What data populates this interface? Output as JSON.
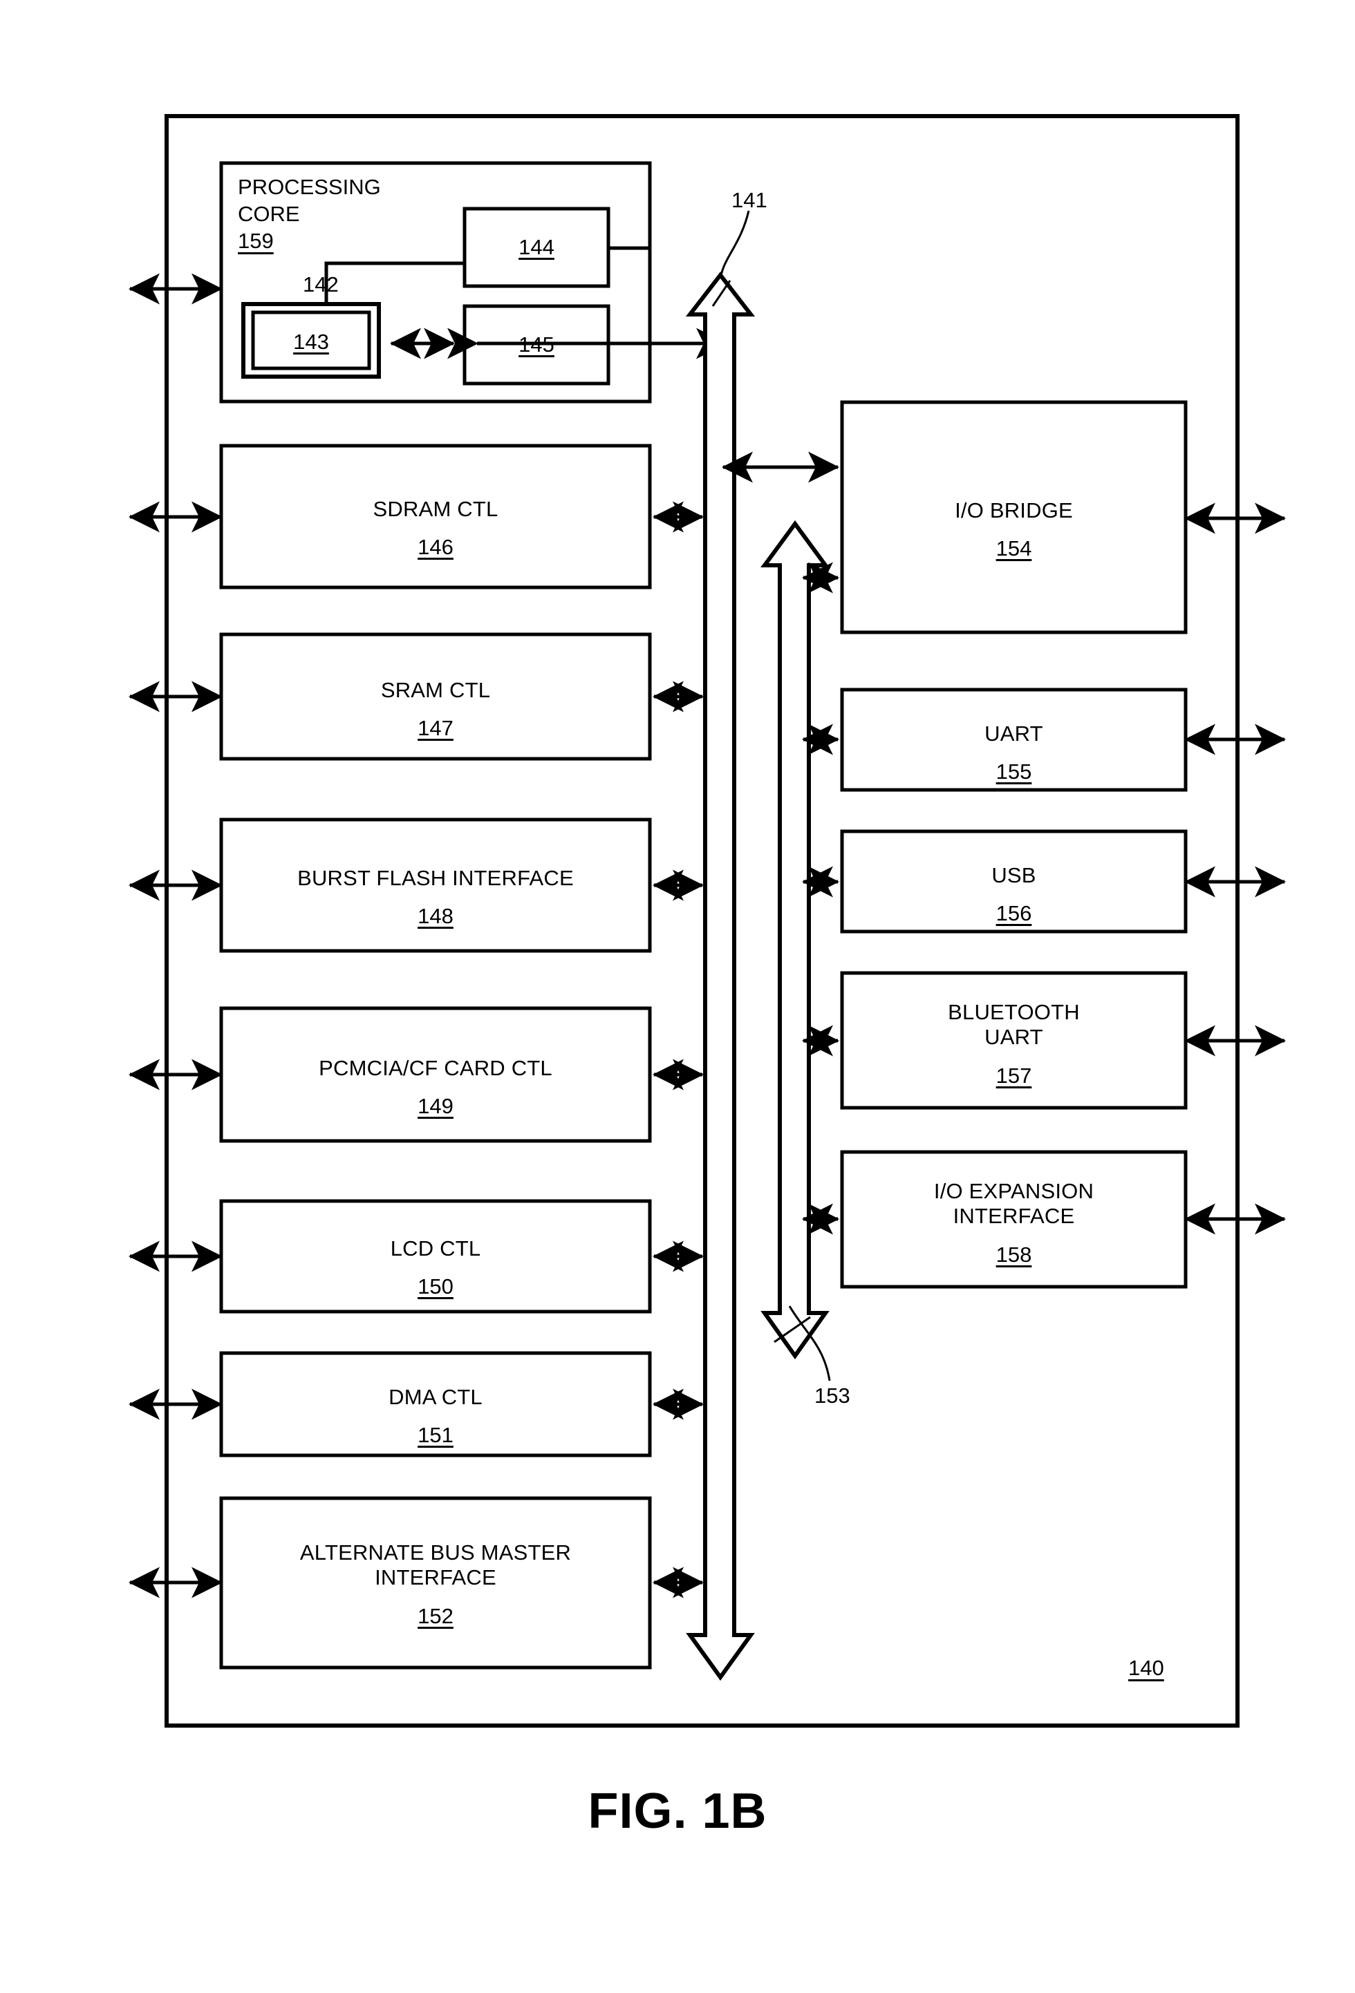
{
  "figure": {
    "caption": "FIG. 1B",
    "system_ref": "140"
  },
  "processing_core": {
    "title_line1": "PROCESSING",
    "title_line2": "CORE",
    "ref": "159",
    "internal_bus_ref": "142",
    "blocks": [
      {
        "id": "cache",
        "ref": "143",
        "nested": true
      },
      {
        "id": "upper_unit",
        "ref": "144",
        "nested": false
      },
      {
        "id": "lower_unit",
        "ref": "145",
        "nested": false
      }
    ]
  },
  "buses": [
    {
      "name": "main-bus",
      "ref": "141"
    },
    {
      "name": "secondary-bus",
      "ref": "153"
    }
  ],
  "left_column": {
    "blocks": [
      {
        "name": "SDRAM CTL",
        "ref": "146"
      },
      {
        "name": "SRAM CTL",
        "ref": "147"
      },
      {
        "name": "BURST FLASH INTERFACE",
        "ref": "148"
      },
      {
        "name": "PCMCIA/CF CARD CTL",
        "ref": "149"
      },
      {
        "name": "LCD CTL",
        "ref": "150"
      },
      {
        "name": "DMA CTL",
        "ref": "151"
      },
      {
        "name": "ALTERNATE BUS MASTER\nINTERFACE",
        "ref": "152"
      }
    ]
  },
  "right_column": {
    "blocks": [
      {
        "name": "I/O BRIDGE",
        "ref": "154"
      },
      {
        "name": "UART",
        "ref": "155"
      },
      {
        "name": "USB",
        "ref": "156"
      },
      {
        "name": "BLUETOOTH\nUART",
        "ref": "157"
      },
      {
        "name": "I/O EXPANSION\nINTERFACE",
        "ref": "158"
      }
    ]
  },
  "colors": {
    "ink": "#000000",
    "paper": "#ffffff"
  }
}
